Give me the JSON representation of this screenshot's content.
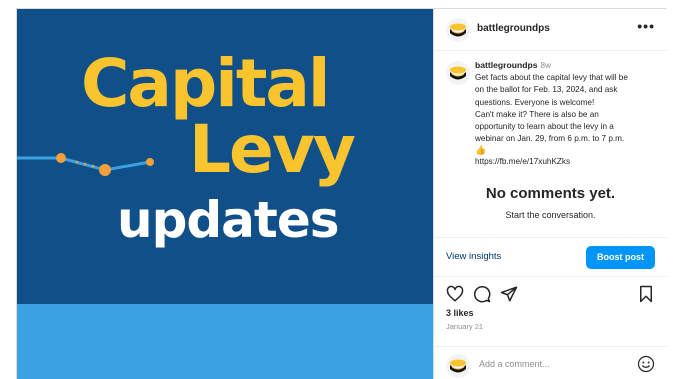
{
  "media": {
    "title_line1": "Capital",
    "title_line2": "Levy",
    "title_line3": "updates",
    "colors": {
      "background": "#114f89",
      "band": "#3aa2e0",
      "title": "#f9c42e",
      "subtitle": "#ffffff",
      "dots": "#f5a03b"
    }
  },
  "header": {
    "username": "battlegroundps",
    "more_icon": "more-horizontal-icon"
  },
  "caption": {
    "username": "battlegroundps",
    "age": "8w",
    "lines": [
      "Get facts about the capital levy that will be",
      "on the ballot for Feb. 13, 2024, and ask",
      "questions. Everyone is welcome!",
      "Can't make it? There is also be an",
      "opportunity to learn about the levy in a",
      "webinar on Jan. 29, from 6 p.m. to 7 p.m."
    ],
    "emoji": "👍",
    "link": "https://fb.me/e/17xuhKZks"
  },
  "comments": {
    "empty_title": "No comments yet.",
    "empty_subtitle": "Start the conversation."
  },
  "insights": {
    "view_label": "View insights",
    "boost_label": "Boost post"
  },
  "actions": {
    "icons": [
      "heart-icon",
      "comment-icon",
      "share-icon",
      "bookmark-icon"
    ],
    "likes": "3 likes",
    "date": "January 21"
  },
  "comment_box": {
    "placeholder": "Add a comment...",
    "emoji_icon": "smile-icon"
  }
}
